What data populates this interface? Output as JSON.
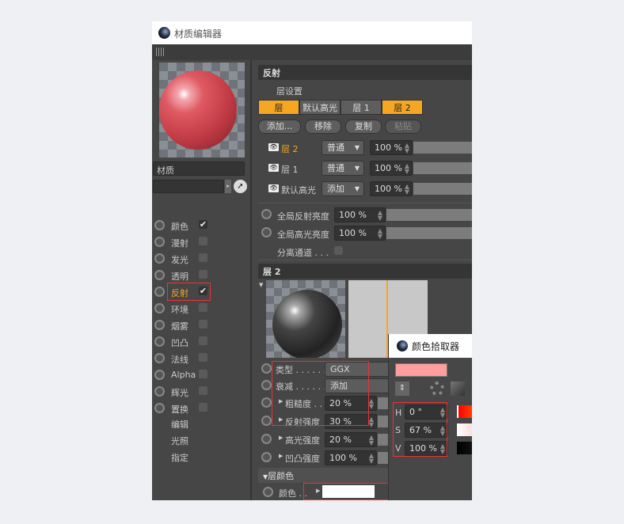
{
  "window": {
    "title": "材质编辑器"
  },
  "left": {
    "material_name": "材质",
    "channels": [
      {
        "label": "颜色",
        "checked": true
      },
      {
        "label": "漫射",
        "checked": false
      },
      {
        "label": "发光",
        "checked": false
      },
      {
        "label": "透明",
        "checked": false
      },
      {
        "label": "反射",
        "checked": true,
        "active": true
      },
      {
        "label": "环境",
        "checked": false
      },
      {
        "label": "烟雾",
        "checked": false
      },
      {
        "label": "凹凸",
        "checked": false
      },
      {
        "label": "法线",
        "checked": false
      },
      {
        "label": "Alpha",
        "checked": false
      },
      {
        "label": "辉光",
        "checked": false
      },
      {
        "label": "置换",
        "checked": false
      }
    ],
    "extra": [
      "编辑",
      "光照",
      "指定"
    ],
    "check_glyph": "✔"
  },
  "reflect": {
    "section_title": "反射",
    "layer_settings": "层设置",
    "tabs": [
      "层",
      "默认高光",
      "层 1",
      "层 2"
    ],
    "buttons": [
      "添加...",
      "移除",
      "复制",
      "粘贴"
    ],
    "layers": [
      {
        "name": "层 2",
        "mode": "普通",
        "value": "100 %"
      },
      {
        "name": "层 1",
        "mode": "普通",
        "value": "100 %"
      },
      {
        "name": "默认高光",
        "mode": "添加",
        "value": "100 %"
      }
    ],
    "global_reflect": {
      "label": "全局反射亮度",
      "value": "100 %"
    },
    "global_spec": {
      "label": "全局高光亮度",
      "value": "100 %"
    },
    "separate": "分离通道 . . ."
  },
  "layer2": {
    "title": "层 2",
    "type_label": "类型 . . . . . .",
    "type_value": "GGX",
    "falloff_label": "衰减 . . . . . .",
    "falloff_value": "添加",
    "roughness_label": "粗糙度 . .",
    "roughness": "20 %",
    "reflect_strength_label": "反射强度",
    "reflect_strength": "30 %",
    "spec_strength_label": "高光强度",
    "spec_strength": "20 %",
    "bump_strength_label": "凹凸强度",
    "bump_strength": "100 %",
    "color_group": "层颜色",
    "color_label": "颜色 . .",
    "color_value": "#ffffff"
  },
  "picker": {
    "title": "颜色拾取器",
    "swatch": "#ff9e9e",
    "h_label": "H",
    "h": "0 °",
    "s_label": "S",
    "s": "67 %",
    "v_label": "V",
    "v": "100 %"
  },
  "colors": {
    "accent": "#f5a623"
  }
}
